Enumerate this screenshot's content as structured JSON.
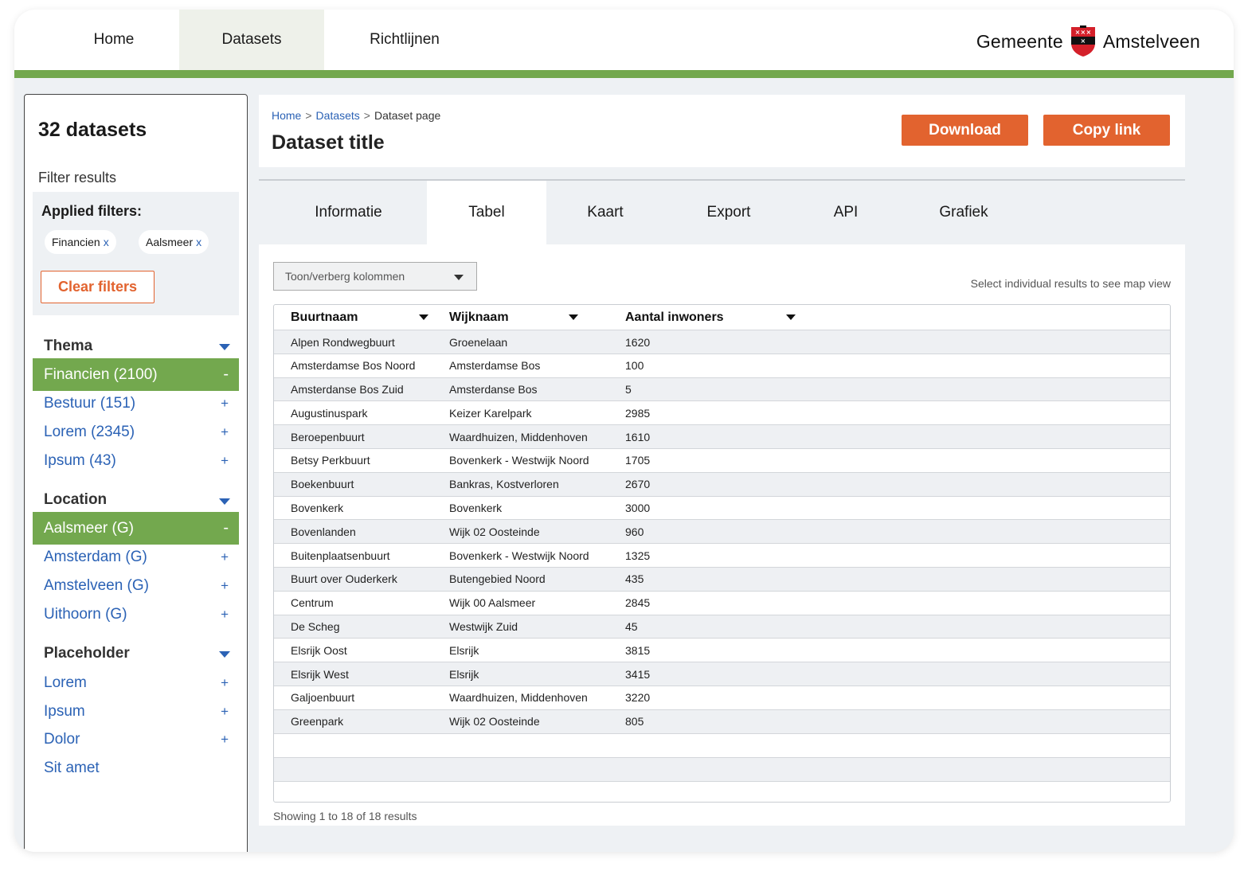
{
  "nav": {
    "items": [
      "Home",
      "Datasets",
      "Richtlijnen"
    ],
    "active": "Datasets"
  },
  "brand": {
    "left": "Gemeente",
    "right": "Amstelveen",
    "icon": "coat-of-arms-icon"
  },
  "colors": {
    "accent_green": "#73a84e",
    "accent_orange": "#e2632f",
    "link_blue": "#2b62b5",
    "page_bg": "#eef1f4"
  },
  "sidebar": {
    "count": "32 datasets",
    "filter_results": "Filter results",
    "applied_title": "Applied filters:",
    "chips": [
      {
        "label": "Financien",
        "x": "x"
      },
      {
        "label": "Aalsmeer",
        "x": "x"
      }
    ],
    "clear_label": "Clear filters",
    "groups": [
      {
        "title": "Thema",
        "items": [
          {
            "label": "Financien (2100)",
            "sign": "-",
            "active": true
          },
          {
            "label": "Bestuur (151)",
            "sign": "+"
          },
          {
            "label": "Lorem (2345)",
            "sign": "+"
          },
          {
            "label": "Ipsum (43)",
            "sign": "+"
          }
        ]
      },
      {
        "title": "Location",
        "items": [
          {
            "label": "Aalsmeer (G)",
            "sign": "-",
            "active": true
          },
          {
            "label": "Amsterdam (G)",
            "sign": "+"
          },
          {
            "label": "Amstelveen (G)",
            "sign": "+"
          },
          {
            "label": "Uithoorn (G)",
            "sign": "+"
          }
        ]
      },
      {
        "title": "Placeholder",
        "items": [
          {
            "label": "Lorem",
            "sign": "+"
          },
          {
            "label": "Ipsum",
            "sign": "+"
          },
          {
            "label": "Dolor",
            "sign": "+"
          },
          {
            "label": "Sit amet",
            "sign": ""
          }
        ]
      }
    ]
  },
  "main": {
    "breadcrumb": {
      "home": "Home",
      "datasets": "Datasets",
      "current": "Dataset page",
      "sep": ">"
    },
    "title": "Dataset title",
    "download_label": "Download",
    "copy_label": "Copy link",
    "tabs": [
      "Informatie",
      "Tabel",
      "Kaart",
      "Export",
      "API",
      "Grafiek"
    ],
    "active_tab": "Tabel",
    "column_toggle": "Toon/verberg kolommen",
    "hint": "Select individual results to see map view",
    "table": {
      "headers": [
        "Buurtnaam",
        "Wijknaam",
        "Aantal inwoners"
      ],
      "rows": [
        [
          "Alpen Rondwegbuurt",
          "Groenelaan",
          "1620"
        ],
        [
          "Amsterdamse Bos Noord",
          "Amsterdamse Bos",
          "100"
        ],
        [
          "Amsterdanse Bos Zuid",
          "Amsterdanse Bos",
          "5"
        ],
        [
          "Augustinuspark",
          "Keizer Karelpark",
          "2985"
        ],
        [
          "Beroepenbuurt",
          "Waardhuizen, Middenhoven",
          "1610"
        ],
        [
          "Betsy Perkbuurt",
          "Bovenkerk - Westwijk Noord",
          "1705"
        ],
        [
          "Boekenbuurt",
          "Bankras, Kostverloren",
          "2670"
        ],
        [
          "Bovenkerk",
          "Bovenkerk",
          "3000"
        ],
        [
          "Bovenlanden",
          "Wijk 02 Oosteinde",
          "960"
        ],
        [
          "Buitenplaatsenbuurt",
          "Bovenkerk - Westwijk Noord",
          "1325"
        ],
        [
          "Buurt over Ouderkerk",
          "Butengebied Noord",
          "435"
        ],
        [
          "Centrum",
          "Wijk 00 Aalsmeer",
          "2845"
        ],
        [
          "De Scheg",
          "Westwijk Zuid",
          "45"
        ],
        [
          "Elsrijk Oost",
          "Elsrijk",
          "3815"
        ],
        [
          "Elsrijk West",
          "Elsrijk",
          "3415"
        ],
        [
          "Galjoenbuurt",
          "Waardhuizen, Middenhoven",
          "3220"
        ],
        [
          "Greenpark",
          "Wijk 02 Oosteinde",
          "805"
        ]
      ]
    },
    "footer": "Showing 1 to 18 of 18 results"
  }
}
